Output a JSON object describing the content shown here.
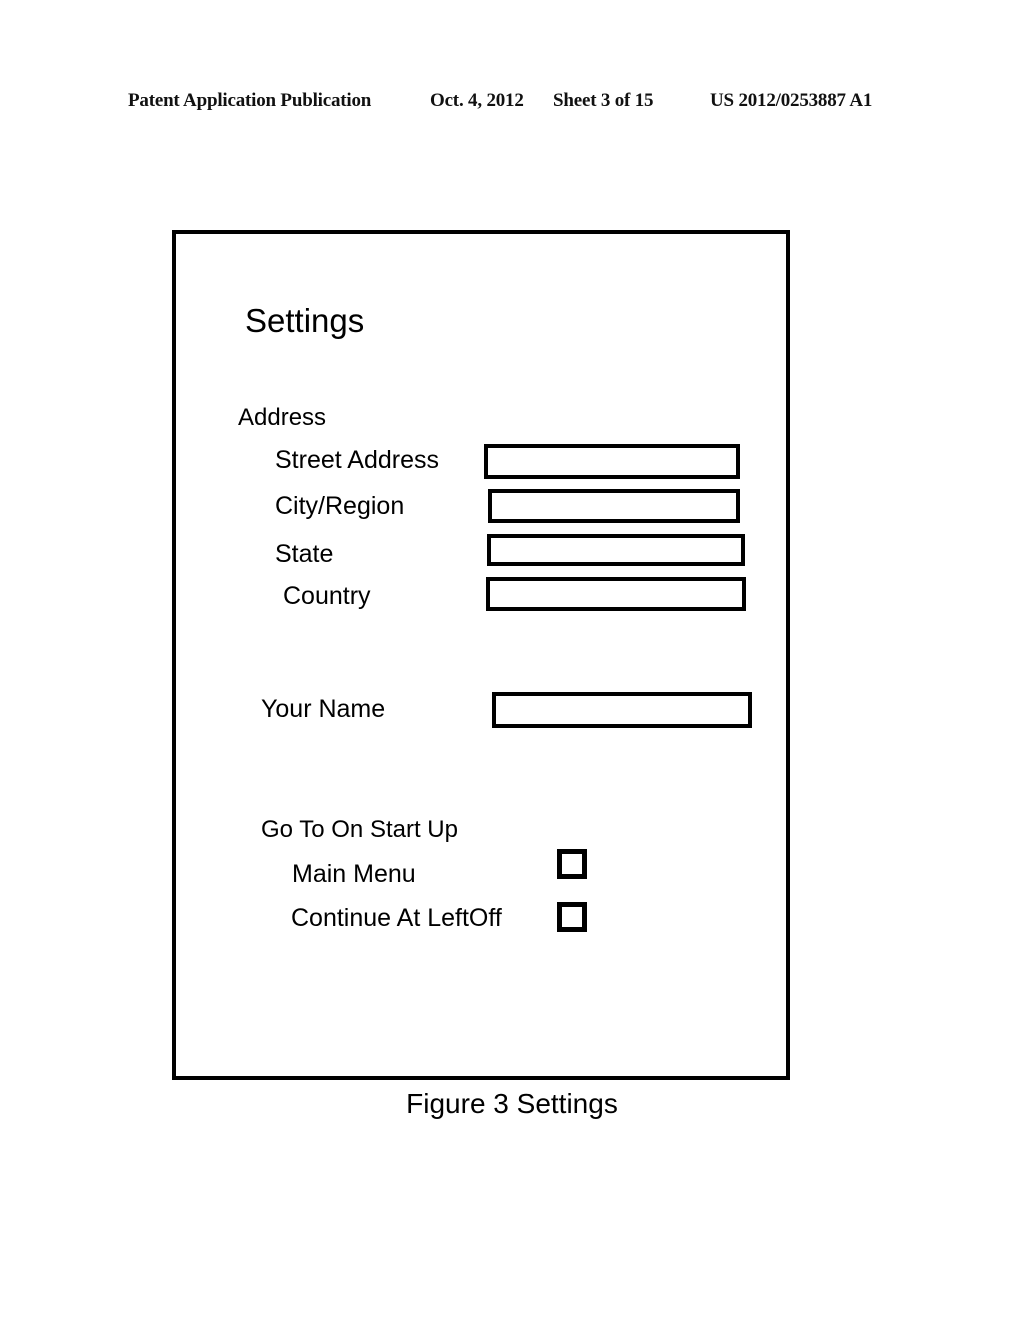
{
  "patent_header": {
    "publication": "Patent Application Publication",
    "date": "Oct. 4, 2012",
    "sheet": "Sheet 3 of 15",
    "publication_number": "US 2012/0253887 A1"
  },
  "figure": {
    "caption": "Figure 3 Settings",
    "border_color": "#000000",
    "background_color": "#ffffff"
  },
  "screen": {
    "title": "Settings",
    "address_group": {
      "heading": "Address",
      "fields": [
        {
          "label": "Street Address",
          "value": "",
          "placeholder": ""
        },
        {
          "label": "City/Region",
          "value": "",
          "placeholder": ""
        },
        {
          "label": "State",
          "value": "",
          "placeholder": ""
        },
        {
          "label": "Country",
          "value": "",
          "placeholder": ""
        }
      ]
    },
    "name_field": {
      "label": "Your Name",
      "value": "",
      "placeholder": ""
    },
    "startup_group": {
      "heading": "Go To On Start Up",
      "options": [
        {
          "label": "Main Menu",
          "checked": false
        },
        {
          "label": "Continue At LeftOff",
          "checked": false
        }
      ]
    }
  }
}
